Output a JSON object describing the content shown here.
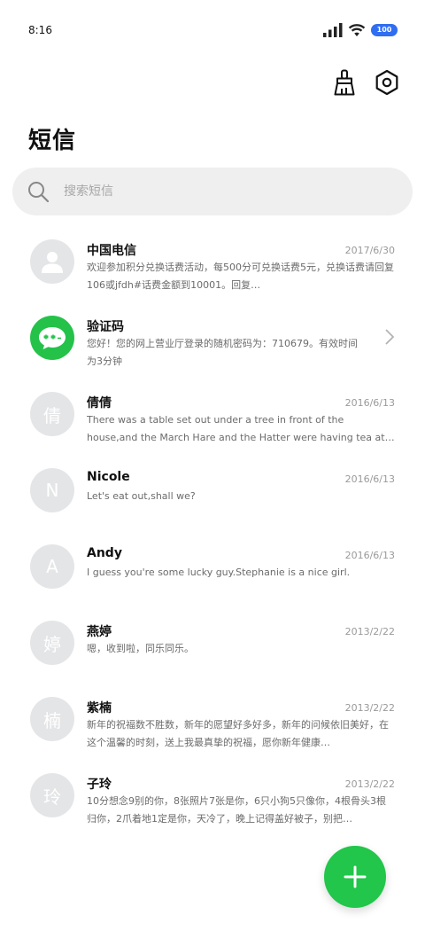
{
  "status_bar": {
    "time": "8:16",
    "battery": "100",
    "icons": [
      "signal-icon",
      "wifi-icon",
      "battery-icon"
    ]
  },
  "toolbar": {
    "icons": [
      "brush-clean-icon",
      "settings-hexagon-icon"
    ]
  },
  "page": {
    "title": "短信"
  },
  "search": {
    "placeholder": "搜索短信",
    "value": ""
  },
  "messages": [
    {
      "sender": "中国电信",
      "date": "2017/6/30",
      "preview": "欢迎参加积分兑换话费活动，每500分可兑换话费5元，兑换话费请回复106或jfdh#话费金额到10001。回复…",
      "avatar": "person-icon"
    },
    {
      "sender": "验证码",
      "date": "",
      "preview": "您好！您的网上营业厅登录的随机密码为：710679。有效时间为3分钟",
      "avatar": "message-bubble-icon"
    },
    {
      "sender": "倩倩",
      "date": "2016/6/13",
      "preview": "There was a table set out under a tree in front of the house,and the March Hare and the Hatter were having tea at it.",
      "avatar": "倩"
    },
    {
      "sender": "Nicole",
      "date": "2016/6/13",
      "preview": "Let's eat out,shall we?",
      "avatar": "N"
    },
    {
      "sender": "Andy",
      "date": "2016/6/13",
      "preview": "I guess you're some lucky guy.Stephanie is a nice girl.",
      "avatar": "A"
    },
    {
      "sender": "燕婷",
      "date": "2013/2/22",
      "preview": "嗯，收到啦，同乐同乐。",
      "avatar": "婷"
    },
    {
      "sender": "紫楠",
      "date": "2013/2/22",
      "preview": "新年的祝福数不胜数，新年的愿望好多好多，新年的问候依旧美好，在这个温馨的时刻，送上我最真挚的祝福，愿你新年健康…",
      "avatar": "楠"
    },
    {
      "sender": "子玲",
      "date": "2013/2/22",
      "preview": "10分想念9别的你，8张照片7张是你，6只小狗5只像你，4根骨头3根归你，2爪着地1定是你，天冷了，晚上记得盖好被子，别把…",
      "avatar": "玲"
    }
  ],
  "fab": {
    "icon": "plus-icon"
  },
  "colors": {
    "accent": "#21c64a",
    "avatar_grey": "#e4e5e7",
    "search_bg": "#efefef",
    "battery": "#2f6df2"
  }
}
